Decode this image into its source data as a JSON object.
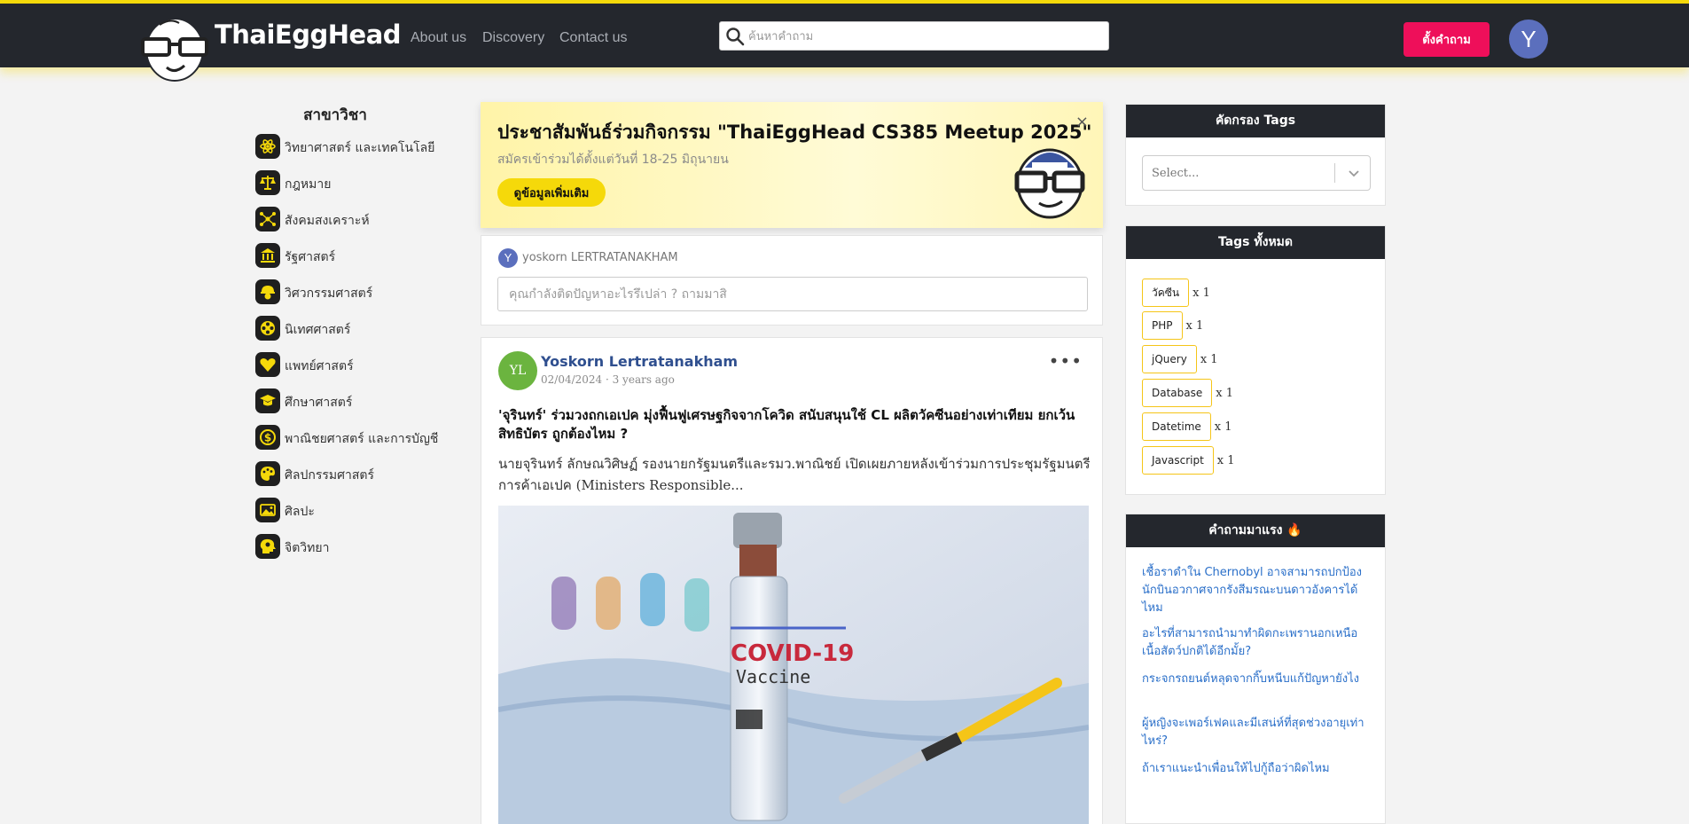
{
  "header": {
    "brand": "ThaiEggHead",
    "nav": [
      "About us",
      "Discovery",
      "Contact us"
    ],
    "search_placeholder": "ค้นหาคำถาม",
    "ask_button": "ตั้งคำถาม",
    "avatar_letter": "Y",
    "accent_color": "#f5d90a",
    "ask_color": "#ee0f5a"
  },
  "sidebar": {
    "title": "สาขาวิชา",
    "items": [
      {
        "label": "วิทยาศาสตร์ และเทคโนโลยี",
        "icon": "atom-icon"
      },
      {
        "label": "กฎหมาย",
        "icon": "scales-icon"
      },
      {
        "label": "สังคมสงเคราะห์",
        "icon": "network-icon"
      },
      {
        "label": "รัฐศาสตร์",
        "icon": "government-building-icon"
      },
      {
        "label": "วิศวกรรมศาสตร์",
        "icon": "engineer-helmet-icon"
      },
      {
        "label": "นิเทศศาสตร์",
        "icon": "film-reel-icon"
      },
      {
        "label": "แพทย์ศาสตร์",
        "icon": "heart-icon"
      },
      {
        "label": "ศึกษาศาสตร์",
        "icon": "graduation-cap-icon"
      },
      {
        "label": "พาณิชยศาสตร์ และการบัญชี",
        "icon": "coin-icon"
      },
      {
        "label": "ศิลปกรรมศาสตร์",
        "icon": "palette-icon"
      },
      {
        "label": "ศิลปะ",
        "icon": "picture-icon"
      },
      {
        "label": "จิตวิทยา",
        "icon": "head-brain-icon"
      }
    ]
  },
  "banner": {
    "title": "ประชาสัมพันธ์ร่วมกิจกรรม \"ThaiEggHead CS385 Meetup 2025\"",
    "subtitle": "สมัครเข้าร่วมได้ตั้งแต่วันที่ 18-25 มิถุนายน",
    "button": "ดูข้อมูลเพิ่มเติม",
    "close": "×"
  },
  "ask_box": {
    "avatar_letter": "Y",
    "username": "yoskorn LERTRATANAKHAM",
    "placeholder": "คุณกำลังติดปัญหาอะไรรึเปล่า ? ถามมาสิ"
  },
  "post": {
    "avatar_initials": "YL",
    "author": "Yoskorn Lertratanakham",
    "date": "02/04/2024 · 3 years ago",
    "menu": "•••",
    "title": "'จุรินทร์' ร่วมวงถกเอเปค มุ่งฟื้นฟูเศรษฐกิจจากโควิด สนับสนุนใช้ CL ผลิตวัคซีนอย่างเท่าเทียม ยกเว้นสิทธิบัตร ถูกต้องไหม ?",
    "excerpt": "นายจุรินทร์ ลักษณวิศิษฏ์   รองนายกรัฐมนตรีและรมว.พาณิชย์ เปิดเผยภายหลังเข้าร่วมการประชุมรัฐมนตรีการค้าเอเปค (Ministers Responsible...",
    "image_text_1": "COVID-19",
    "image_text_2": "Vaccine"
  },
  "filter": {
    "title": "คัดกรอง Tags",
    "select_value": "Select..."
  },
  "tags": {
    "title": "Tags ทั้งหมด",
    "items": [
      {
        "name": "วัคซีน",
        "count": "x 1"
      },
      {
        "name": "PHP",
        "count": "x 1"
      },
      {
        "name": "jQuery",
        "count": "x 1"
      },
      {
        "name": "Database",
        "count": "x 1"
      },
      {
        "name": "Datetime",
        "count": "x 1"
      },
      {
        "name": "Javascript",
        "count": "x 1"
      }
    ]
  },
  "hot": {
    "title": "คำถามมาแรง 🔥",
    "items": [
      "เชื้อราดำใน Chernobyl อาจสามารถปกป้องนักบินอวกาศจากรังสีมรณะบนดาวอังคารได้ไหม",
      "อะไรที่สามารถนำมาทำผิดกะเพรานอกเหนือเนื้อสัตว์ปกติได้อีกมั้ย?",
      "กระจกรถยนต์หลุดจากกิ๊บหนีบแก้ปัญหายังไง",
      "ผู้หญิงจะเพอร์เฟคและมีเสน่ห์ที่สุดช่วงอายุเท่าไหร่?",
      "ถ้าเราแนะนำเพื่อนให้ไปกู้ถือว่าผิดไหม"
    ]
  }
}
